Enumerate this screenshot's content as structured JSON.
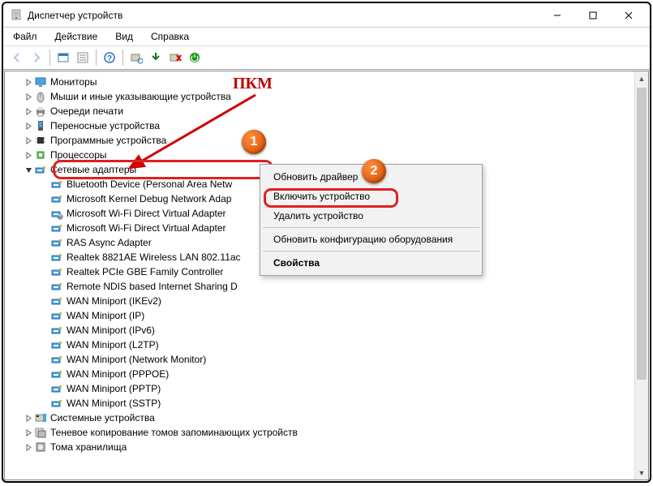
{
  "window": {
    "title": "Диспетчер устройств"
  },
  "menus": {
    "file": "Файл",
    "action": "Действие",
    "view": "Вид",
    "help": "Справка"
  },
  "annot": {
    "pkm": "ПКМ",
    "marker1": "1",
    "marker2": "2"
  },
  "categories": {
    "monitors": "Мониторы",
    "mice": "Мыши и иные указывающие устройства",
    "printq": "Очереди печати",
    "portable": "Переносные устройства",
    "firmware": "Программные устройства",
    "cpu": "Процессоры",
    "net": "Сетевые адаптеры",
    "sysdev": "Системные устройства",
    "vss": "Теневое копирование томов запоминающих устройств",
    "storage": "Тома хранилища"
  },
  "net_items": [
    "Bluetooth Device (Personal Area Netw",
    "Microsoft Kernel Debug Network Adap",
    "Microsoft Wi-Fi Direct Virtual Adapter",
    "Microsoft Wi-Fi Direct Virtual Adapter",
    "RAS Async Adapter",
    "Realtek 8821AE Wireless LAN 802.11ac",
    "Realtek PCIe GBE Family Controller",
    "Remote NDIS based Internet Sharing D",
    "WAN Miniport (IKEv2)",
    "WAN Miniport (IP)",
    "WAN Miniport (IPv6)",
    "WAN Miniport (L2TP)",
    "WAN Miniport (Network Monitor)",
    "WAN Miniport (PPPOE)",
    "WAN Miniport (PPTP)",
    "WAN Miniport (SSTP)"
  ],
  "ctx": {
    "update": "Обновить драйвер",
    "enable": "Включить устройство",
    "uninstall": "Удалить устройство",
    "scan": "Обновить конфигурацию оборудования",
    "props": "Свойства"
  }
}
